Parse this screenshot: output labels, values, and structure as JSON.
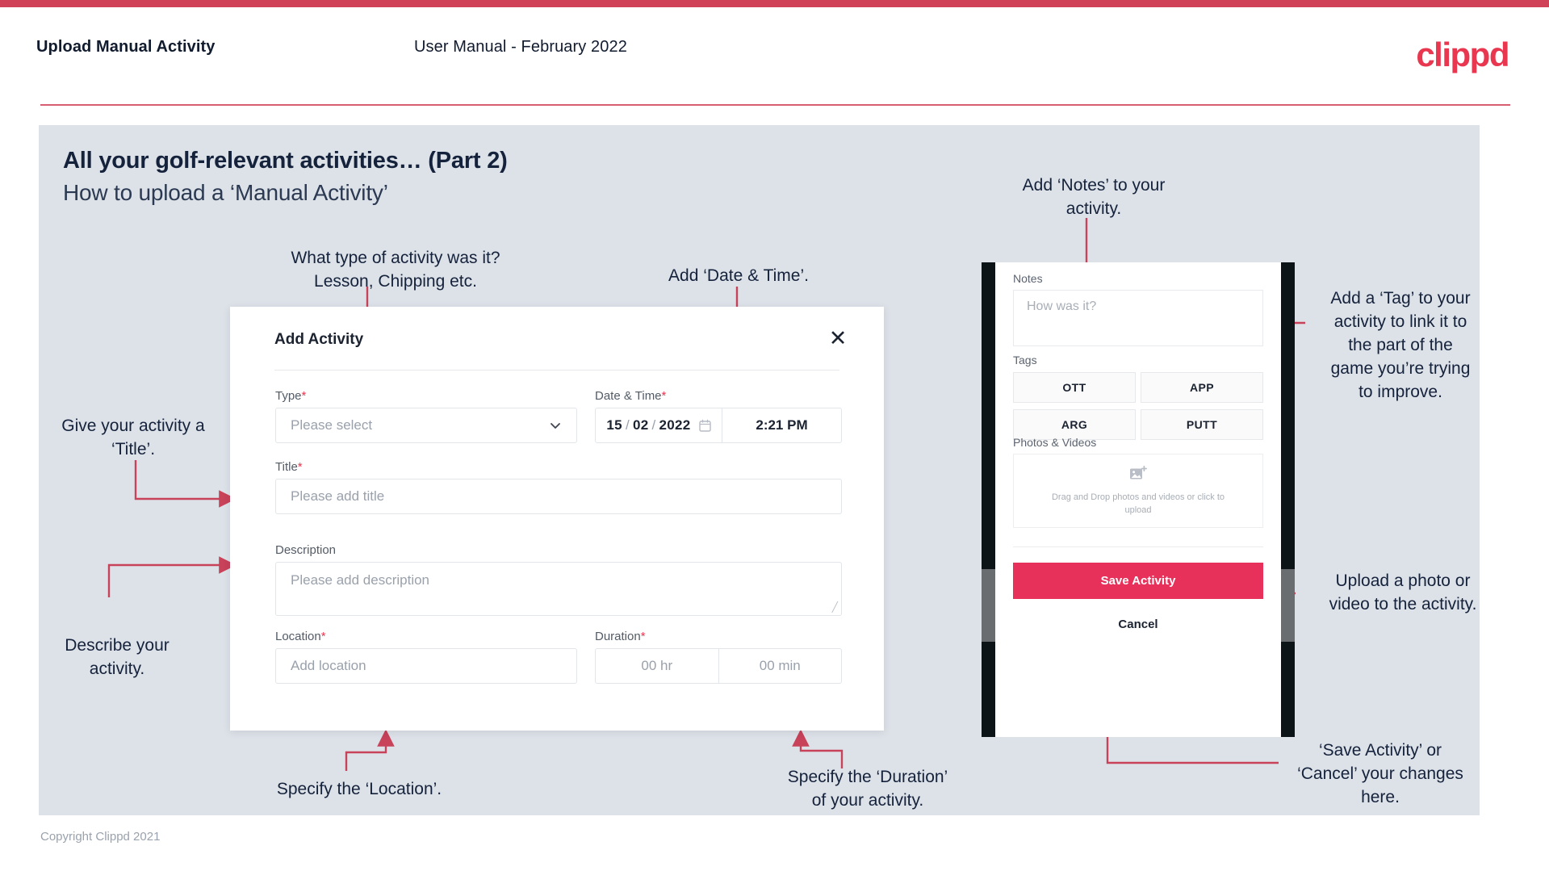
{
  "header": {
    "left_title": "Upload Manual Activity",
    "center_title": "User Manual - February 2022",
    "logo": "clippd"
  },
  "slide": {
    "title": "All your golf-relevant activities… (Part 2)",
    "subtitle": "How to upload a ‘Manual Activity’",
    "footer": "Copyright Clippd 2021"
  },
  "annotations": {
    "type": "What type of activity was it?\nLesson, Chipping etc.",
    "datetime": "Add ‘Date & Time’.",
    "title_field": "Give your activity a\n‘Title’.",
    "description": "Describe your\nactivity.",
    "location": "Specify the ‘Location’.",
    "duration": "Specify the ‘Duration’\nof your activity.",
    "notes": "Add ‘Notes’ to your\nactivity.",
    "tags": "Add a ‘Tag’ to your\nactivity to link it to\nthe part of the\ngame you’re trying\nto improve.",
    "upload": "Upload a photo or\nvideo to the activity.",
    "save_cancel": "‘Save Activity’ or\n‘Cancel’ your changes\nhere."
  },
  "dialog": {
    "title": "Add Activity",
    "close_icon": "close-icon",
    "fields": {
      "type": {
        "label": "Type",
        "required": "*",
        "placeholder": "Please select",
        "value": ""
      },
      "datetime": {
        "label": "Date & Time",
        "required": "*",
        "day": "15",
        "month": "02",
        "year": "2022",
        "sep": "/",
        "time": "2:21 PM",
        "calendar_icon": "calendar-icon"
      },
      "title": {
        "label": "Title",
        "required": "*",
        "placeholder": "Please add title",
        "value": ""
      },
      "description": {
        "label": "Description",
        "required": "",
        "placeholder": "Please add description",
        "value": ""
      },
      "location": {
        "label": "Location",
        "required": "*",
        "placeholder": "Add location",
        "value": ""
      },
      "duration": {
        "label": "Duration",
        "required": "*",
        "hours_placeholder": "00 hr",
        "minutes_placeholder": "00 min"
      }
    }
  },
  "phone": {
    "notes": {
      "label": "Notes",
      "placeholder": "How was it?"
    },
    "tags": {
      "label": "Tags",
      "items": [
        "OTT",
        "APP",
        "ARG",
        "PUTT"
      ]
    },
    "media": {
      "label": "Photos & Videos",
      "icon": "add-image-icon",
      "text": "Drag and Drop photos and videos or click to upload"
    },
    "save_label": "Save Activity",
    "cancel_label": "Cancel"
  },
  "colors": {
    "accent": "#e8374f",
    "accent_bar": "#cf4257",
    "save_button": "#e8315a",
    "slide_bg": "#dde2e9",
    "text_dark": "#15223b"
  }
}
